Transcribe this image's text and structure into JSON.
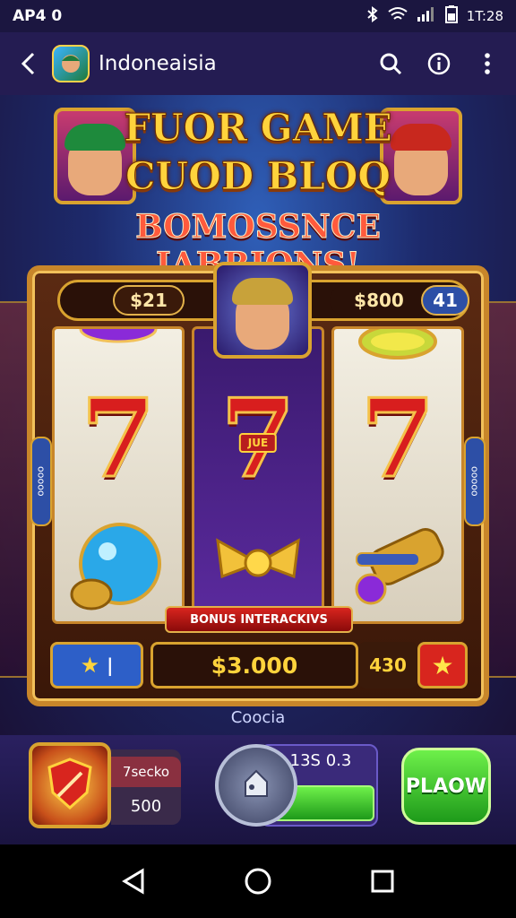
{
  "status_bar": {
    "left_text": "AP4 0",
    "time": "1T:28",
    "icons": [
      "bluetooth-icon",
      "wifi-icon",
      "signal-icon",
      "battery-icon"
    ]
  },
  "app_bar": {
    "title": "Indoneaisia",
    "icons": [
      "back-arrow-icon",
      "app-icon",
      "search-icon",
      "info-icon",
      "more-vert-icon"
    ]
  },
  "game": {
    "title_line1": "FUOR GAME",
    "title_line2": "CUOD BLOQ",
    "title_line3": "BOMOSSNCE IABRIONS!",
    "top_left_value": "$21",
    "top_mid_value": "$800",
    "top_right_value": "41",
    "side_left_label": "ooooo",
    "side_right_label": "ooooo",
    "reel_badge": "JUE",
    "bonus_banner": "BONUS INTERACKIVS",
    "bottom_left_value": "|",
    "win_amount": "$3.000",
    "bottom_right_value": "430",
    "coin_label": "Coocia"
  },
  "controls": {
    "bet_label": "7secko",
    "bet_value": "500",
    "spin_label": "13S 0.3",
    "play_label": "PLAOW"
  },
  "colors": {
    "gold": "#d9a32f",
    "title_yellow": "#ffd33c",
    "title_red": "#ff5a3c",
    "play_green": "#1e9a1a"
  }
}
